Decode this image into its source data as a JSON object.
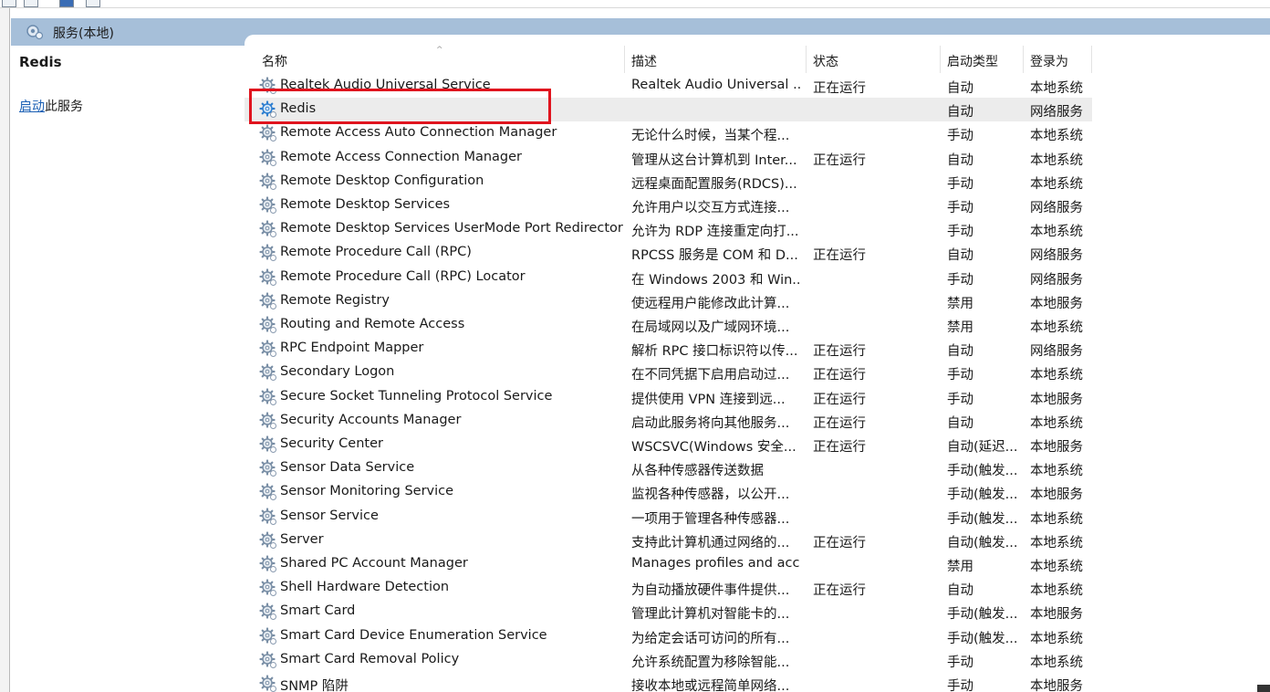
{
  "header": {
    "title": "服务(本地)",
    "icon": "services-icon"
  },
  "description_pane": {
    "service_name": "Redis",
    "action_link": "启动",
    "action_suffix": "此服务"
  },
  "columns": {
    "name": "名称",
    "description": "描述",
    "status": "状态",
    "startup": "启动类型",
    "logon": "登录为"
  },
  "colors": {
    "header_bar": "#a6bfd9",
    "selected_row": "#ececec",
    "highlight_border": "#e0141e",
    "link": "#1a5fb4"
  },
  "rows": [
    {
      "name": "Realtek Audio Universal Service",
      "description": "Realtek Audio Universal ...",
      "status": "正在运行",
      "startup": "自动",
      "logon": "本地系统"
    },
    {
      "name": "Redis",
      "description": "",
      "status": "",
      "startup": "自动",
      "logon": "网络服务",
      "selected": true
    },
    {
      "name": "Remote Access Auto Connection Manager",
      "description": "无论什么时候，当某个程...",
      "status": "",
      "startup": "手动",
      "logon": "本地系统"
    },
    {
      "name": "Remote Access Connection Manager",
      "description": "管理从这台计算机到 Inter...",
      "status": "正在运行",
      "startup": "自动",
      "logon": "本地系统"
    },
    {
      "name": "Remote Desktop Configuration",
      "description": "远程桌面配置服务(RDCS)...",
      "status": "",
      "startup": "手动",
      "logon": "本地系统"
    },
    {
      "name": "Remote Desktop Services",
      "description": "允许用户以交互方式连接...",
      "status": "",
      "startup": "手动",
      "logon": "网络服务"
    },
    {
      "name": "Remote Desktop Services UserMode Port Redirector",
      "description": "允许为 RDP 连接重定向打...",
      "status": "",
      "startup": "手动",
      "logon": "本地系统"
    },
    {
      "name": "Remote Procedure Call (RPC)",
      "description": "RPCSS 服务是 COM 和 D...",
      "status": "正在运行",
      "startup": "自动",
      "logon": "网络服务"
    },
    {
      "name": "Remote Procedure Call (RPC) Locator",
      "description": "在 Windows 2003 和 Win...",
      "status": "",
      "startup": "手动",
      "logon": "网络服务"
    },
    {
      "name": "Remote Registry",
      "description": "使远程用户能修改此计算...",
      "status": "",
      "startup": "禁用",
      "logon": "本地服务"
    },
    {
      "name": "Routing and Remote Access",
      "description": "在局域网以及广域网环境...",
      "status": "",
      "startup": "禁用",
      "logon": "本地系统"
    },
    {
      "name": "RPC Endpoint Mapper",
      "description": "解析 RPC 接口标识符以传...",
      "status": "正在运行",
      "startup": "自动",
      "logon": "网络服务"
    },
    {
      "name": "Secondary Logon",
      "description": "在不同凭据下启用启动过...",
      "status": "正在运行",
      "startup": "手动",
      "logon": "本地系统"
    },
    {
      "name": "Secure Socket Tunneling Protocol Service",
      "description": "提供使用 VPN 连接到远...",
      "status": "正在运行",
      "startup": "手动",
      "logon": "本地服务"
    },
    {
      "name": "Security Accounts Manager",
      "description": "启动此服务将向其他服务...",
      "status": "正在运行",
      "startup": "自动",
      "logon": "本地系统"
    },
    {
      "name": "Security Center",
      "description": "WSCSVC(Windows 安全...",
      "status": "正在运行",
      "startup": "自动(延迟...",
      "logon": "本地服务"
    },
    {
      "name": "Sensor Data Service",
      "description": "从各种传感器传送数据",
      "status": "",
      "startup": "手动(触发...",
      "logon": "本地系统"
    },
    {
      "name": "Sensor Monitoring Service",
      "description": "监视各种传感器，以公开...",
      "status": "",
      "startup": "手动(触发...",
      "logon": "本地服务"
    },
    {
      "name": "Sensor Service",
      "description": "一项用于管理各种传感器...",
      "status": "",
      "startup": "手动(触发...",
      "logon": "本地系统"
    },
    {
      "name": "Server",
      "description": "支持此计算机通过网络的...",
      "status": "正在运行",
      "startup": "自动(触发...",
      "logon": "本地系统"
    },
    {
      "name": "Shared PC Account Manager",
      "description": "Manages profiles and acc...",
      "status": "",
      "startup": "禁用",
      "logon": "本地系统"
    },
    {
      "name": "Shell Hardware Detection",
      "description": "为自动播放硬件事件提供...",
      "status": "正在运行",
      "startup": "自动",
      "logon": "本地系统"
    },
    {
      "name": "Smart Card",
      "description": "管理此计算机对智能卡的...",
      "status": "",
      "startup": "手动(触发...",
      "logon": "本地服务"
    },
    {
      "name": "Smart Card Device Enumeration Service",
      "description": "为给定会话可访问的所有...",
      "status": "",
      "startup": "手动(触发...",
      "logon": "本地系统"
    },
    {
      "name": "Smart Card Removal Policy",
      "description": "允许系统配置为移除智能...",
      "status": "",
      "startup": "手动",
      "logon": "本地系统"
    },
    {
      "name": "SNMP 陷阱",
      "description": "接收本地或远程简单网络...",
      "status": "",
      "startup": "手动",
      "logon": "本地服务"
    }
  ]
}
